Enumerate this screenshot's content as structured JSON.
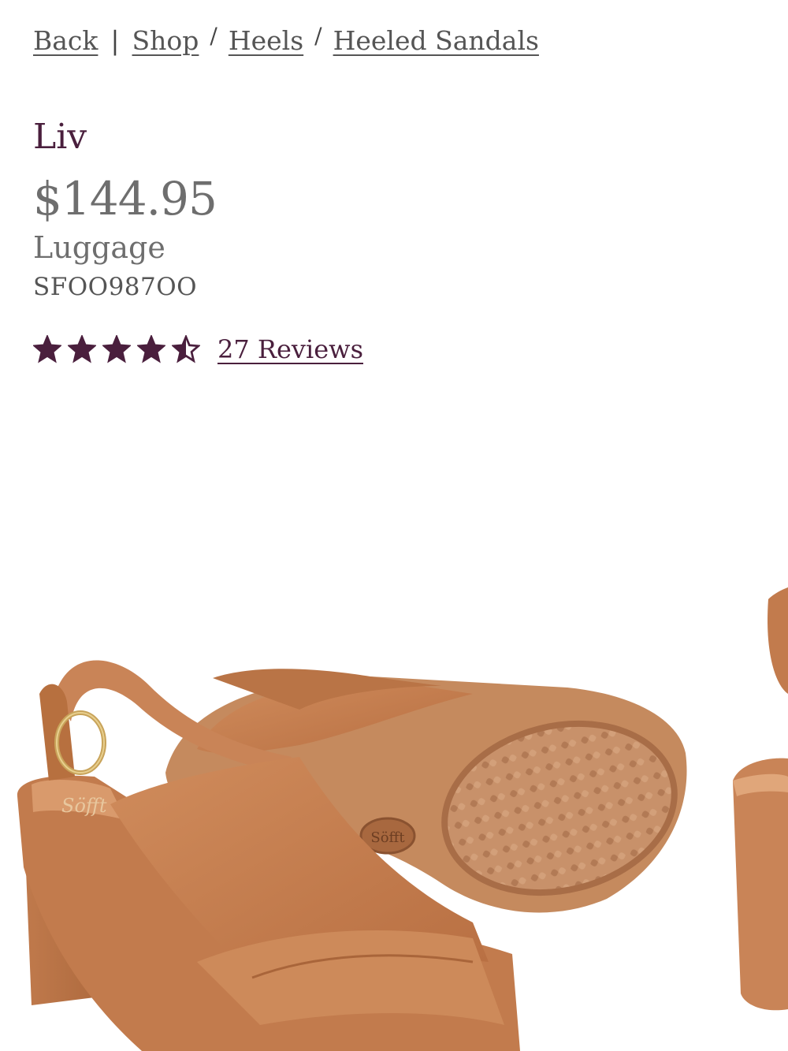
{
  "breadcrumb": {
    "back_label": "Back",
    "divider": "|",
    "items": [
      {
        "label": "Shop"
      },
      {
        "label": "Heels"
      },
      {
        "label": "Heeled Sandals"
      }
    ],
    "slash": "/"
  },
  "product": {
    "name": "Liv",
    "price": "$144.95",
    "color": "Luggage",
    "sku": "SFOO987OO",
    "rating": 4.5,
    "rating_max": 5,
    "reviews_label": "27 Reviews",
    "image_logo_text": "Söfft"
  },
  "colors": {
    "accent": "#4a1f3d",
    "text_gray": "#6e6e6e",
    "leather": "#c98457",
    "sole": "#c89670"
  }
}
